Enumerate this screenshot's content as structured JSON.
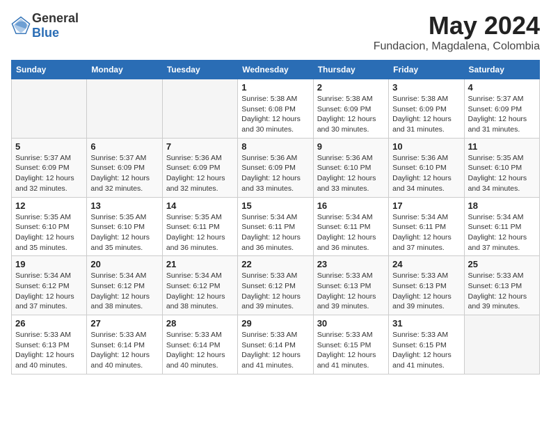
{
  "header": {
    "logo_general": "General",
    "logo_blue": "Blue",
    "month": "May 2024",
    "location": "Fundacion, Magdalena, Colombia"
  },
  "weekdays": [
    "Sunday",
    "Monday",
    "Tuesday",
    "Wednesday",
    "Thursday",
    "Friday",
    "Saturday"
  ],
  "weeks": [
    [
      {
        "day": "",
        "info": ""
      },
      {
        "day": "",
        "info": ""
      },
      {
        "day": "",
        "info": ""
      },
      {
        "day": "1",
        "info": "Sunrise: 5:38 AM\nSunset: 6:08 PM\nDaylight: 12 hours\nand 30 minutes."
      },
      {
        "day": "2",
        "info": "Sunrise: 5:38 AM\nSunset: 6:09 PM\nDaylight: 12 hours\nand 30 minutes."
      },
      {
        "day": "3",
        "info": "Sunrise: 5:38 AM\nSunset: 6:09 PM\nDaylight: 12 hours\nand 31 minutes."
      },
      {
        "day": "4",
        "info": "Sunrise: 5:37 AM\nSunset: 6:09 PM\nDaylight: 12 hours\nand 31 minutes."
      }
    ],
    [
      {
        "day": "5",
        "info": "Sunrise: 5:37 AM\nSunset: 6:09 PM\nDaylight: 12 hours\nand 32 minutes."
      },
      {
        "day": "6",
        "info": "Sunrise: 5:37 AM\nSunset: 6:09 PM\nDaylight: 12 hours\nand 32 minutes."
      },
      {
        "day": "7",
        "info": "Sunrise: 5:36 AM\nSunset: 6:09 PM\nDaylight: 12 hours\nand 32 minutes."
      },
      {
        "day": "8",
        "info": "Sunrise: 5:36 AM\nSunset: 6:09 PM\nDaylight: 12 hours\nand 33 minutes."
      },
      {
        "day": "9",
        "info": "Sunrise: 5:36 AM\nSunset: 6:10 PM\nDaylight: 12 hours\nand 33 minutes."
      },
      {
        "day": "10",
        "info": "Sunrise: 5:36 AM\nSunset: 6:10 PM\nDaylight: 12 hours\nand 34 minutes."
      },
      {
        "day": "11",
        "info": "Sunrise: 5:35 AM\nSunset: 6:10 PM\nDaylight: 12 hours\nand 34 minutes."
      }
    ],
    [
      {
        "day": "12",
        "info": "Sunrise: 5:35 AM\nSunset: 6:10 PM\nDaylight: 12 hours\nand 35 minutes."
      },
      {
        "day": "13",
        "info": "Sunrise: 5:35 AM\nSunset: 6:10 PM\nDaylight: 12 hours\nand 35 minutes."
      },
      {
        "day": "14",
        "info": "Sunrise: 5:35 AM\nSunset: 6:11 PM\nDaylight: 12 hours\nand 36 minutes."
      },
      {
        "day": "15",
        "info": "Sunrise: 5:34 AM\nSunset: 6:11 PM\nDaylight: 12 hours\nand 36 minutes."
      },
      {
        "day": "16",
        "info": "Sunrise: 5:34 AM\nSunset: 6:11 PM\nDaylight: 12 hours\nand 36 minutes."
      },
      {
        "day": "17",
        "info": "Sunrise: 5:34 AM\nSunset: 6:11 PM\nDaylight: 12 hours\nand 37 minutes."
      },
      {
        "day": "18",
        "info": "Sunrise: 5:34 AM\nSunset: 6:11 PM\nDaylight: 12 hours\nand 37 minutes."
      }
    ],
    [
      {
        "day": "19",
        "info": "Sunrise: 5:34 AM\nSunset: 6:12 PM\nDaylight: 12 hours\nand 37 minutes."
      },
      {
        "day": "20",
        "info": "Sunrise: 5:34 AM\nSunset: 6:12 PM\nDaylight: 12 hours\nand 38 minutes."
      },
      {
        "day": "21",
        "info": "Sunrise: 5:34 AM\nSunset: 6:12 PM\nDaylight: 12 hours\nand 38 minutes."
      },
      {
        "day": "22",
        "info": "Sunrise: 5:33 AM\nSunset: 6:12 PM\nDaylight: 12 hours\nand 39 minutes."
      },
      {
        "day": "23",
        "info": "Sunrise: 5:33 AM\nSunset: 6:13 PM\nDaylight: 12 hours\nand 39 minutes."
      },
      {
        "day": "24",
        "info": "Sunrise: 5:33 AM\nSunset: 6:13 PM\nDaylight: 12 hours\nand 39 minutes."
      },
      {
        "day": "25",
        "info": "Sunrise: 5:33 AM\nSunset: 6:13 PM\nDaylight: 12 hours\nand 39 minutes."
      }
    ],
    [
      {
        "day": "26",
        "info": "Sunrise: 5:33 AM\nSunset: 6:13 PM\nDaylight: 12 hours\nand 40 minutes."
      },
      {
        "day": "27",
        "info": "Sunrise: 5:33 AM\nSunset: 6:14 PM\nDaylight: 12 hours\nand 40 minutes."
      },
      {
        "day": "28",
        "info": "Sunrise: 5:33 AM\nSunset: 6:14 PM\nDaylight: 12 hours\nand 40 minutes."
      },
      {
        "day": "29",
        "info": "Sunrise: 5:33 AM\nSunset: 6:14 PM\nDaylight: 12 hours\nand 41 minutes."
      },
      {
        "day": "30",
        "info": "Sunrise: 5:33 AM\nSunset: 6:15 PM\nDaylight: 12 hours\nand 41 minutes."
      },
      {
        "day": "31",
        "info": "Sunrise: 5:33 AM\nSunset: 6:15 PM\nDaylight: 12 hours\nand 41 minutes."
      },
      {
        "day": "",
        "info": ""
      }
    ]
  ]
}
